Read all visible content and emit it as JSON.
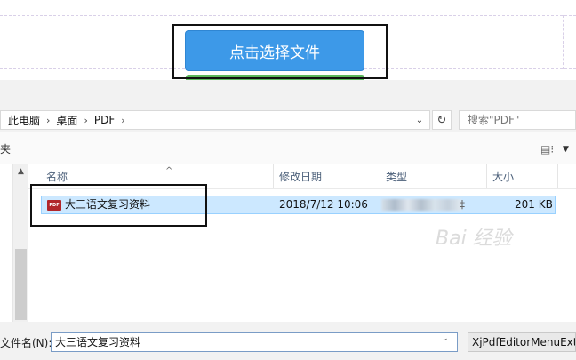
{
  "web": {
    "select_file_button": "点击选择文件"
  },
  "address_bar": {
    "crumbs": [
      "此电脑",
      "桌面",
      "PDF"
    ],
    "separator": "›"
  },
  "search": {
    "placeholder": "搜索\"PDF\""
  },
  "toolbar": {
    "left_label": "夹"
  },
  "columns": {
    "name": "名称",
    "date": "修改日期",
    "type": "类型",
    "size": "大小"
  },
  "files": [
    {
      "name": "大三语文复习资料",
      "date": "2018/7/12 10:06",
      "type_suffix": "‡",
      "size": "201 KB"
    }
  ],
  "bottom": {
    "filename_label": "文件名(N):",
    "filename_value": "大三语文复习资料",
    "filetype": "XjPdfEditorMenuExt"
  },
  "colors": {
    "select_button": "#3d99e8",
    "row_selected": "#cce8ff"
  },
  "icons": [
    "chevron-down-icon",
    "refresh-icon",
    "view-options-icon",
    "pdf-file-icon",
    "sort-up-icon"
  ]
}
